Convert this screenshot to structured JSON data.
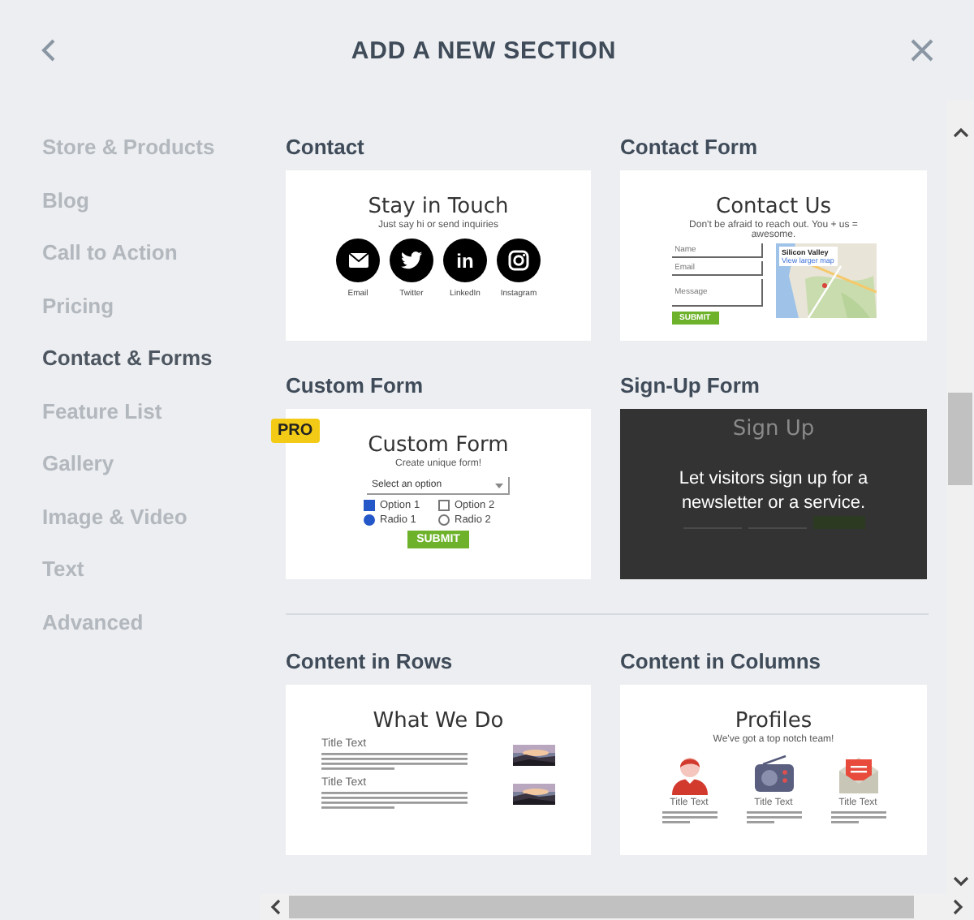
{
  "header": {
    "title": "ADD A NEW SECTION"
  },
  "sidebar": {
    "items": [
      {
        "label": "Store & Products",
        "selected": false
      },
      {
        "label": "Blog",
        "selected": false
      },
      {
        "label": "Call to Action",
        "selected": false
      },
      {
        "label": "Pricing",
        "selected": false
      },
      {
        "label": "Contact & Forms",
        "selected": true
      },
      {
        "label": "Feature List",
        "selected": false
      },
      {
        "label": "Gallery",
        "selected": false
      },
      {
        "label": "Image & Video",
        "selected": false
      },
      {
        "label": "Text",
        "selected": false
      },
      {
        "label": "Advanced",
        "selected": false
      }
    ]
  },
  "groups": [
    {
      "cards": [
        {
          "title": "Contact",
          "kind": "contact",
          "heading": "Stay in Touch",
          "subtitle": "Just say hi or send inquiries",
          "socials": [
            {
              "kind": "email",
              "label": "Email"
            },
            {
              "kind": "twitter",
              "label": "Twitter"
            },
            {
              "kind": "linkedin",
              "label": "LinkedIn",
              "glyph": "in"
            },
            {
              "kind": "instagram",
              "label": "Instagram"
            }
          ]
        },
        {
          "title": "Contact Form",
          "kind": "contact_form",
          "heading": "Contact Us",
          "subtitle": "Don't be afraid to reach out. You + us = awesome.",
          "fields": [
            {
              "placeholder": "Name"
            },
            {
              "placeholder": "Email"
            },
            {
              "placeholder": "Message"
            }
          ],
          "map": {
            "place": "Silicon Valley",
            "link": "View larger map"
          },
          "submit": "SUBMIT"
        },
        {
          "title": "Custom Form",
          "kind": "custom_form",
          "badge": "PRO",
          "heading": "Custom Form",
          "subtitle": "Create unique form!",
          "select": "Select an option",
          "checkboxes": [
            {
              "label": "Option 1",
              "checked": true
            },
            {
              "label": "Option 2",
              "checked": false
            }
          ],
          "radios": [
            {
              "label": "Radio 1",
              "selected": true
            },
            {
              "label": "Radio 2",
              "selected": false
            }
          ],
          "submit": "SUBMIT"
        },
        {
          "title": "Sign-Up Form",
          "kind": "signup",
          "heading": "Sign Up",
          "overlay": "Let visitors sign up for a newsletter or a service."
        }
      ]
    },
    {
      "cards": [
        {
          "title": "Content in Rows",
          "kind": "rows",
          "heading": "What We Do",
          "items": [
            {
              "title": "Title Text"
            },
            {
              "title": "Title Text"
            }
          ]
        },
        {
          "title": "Content in Columns",
          "kind": "columns",
          "heading": "Profiles",
          "subtitle": "We've got a top notch team!",
          "items": [
            {
              "kind": "person",
              "title": "Title Text"
            },
            {
              "kind": "radio",
              "title": "Title Text"
            },
            {
              "kind": "mail",
              "title": "Title Text"
            }
          ]
        }
      ]
    }
  ]
}
